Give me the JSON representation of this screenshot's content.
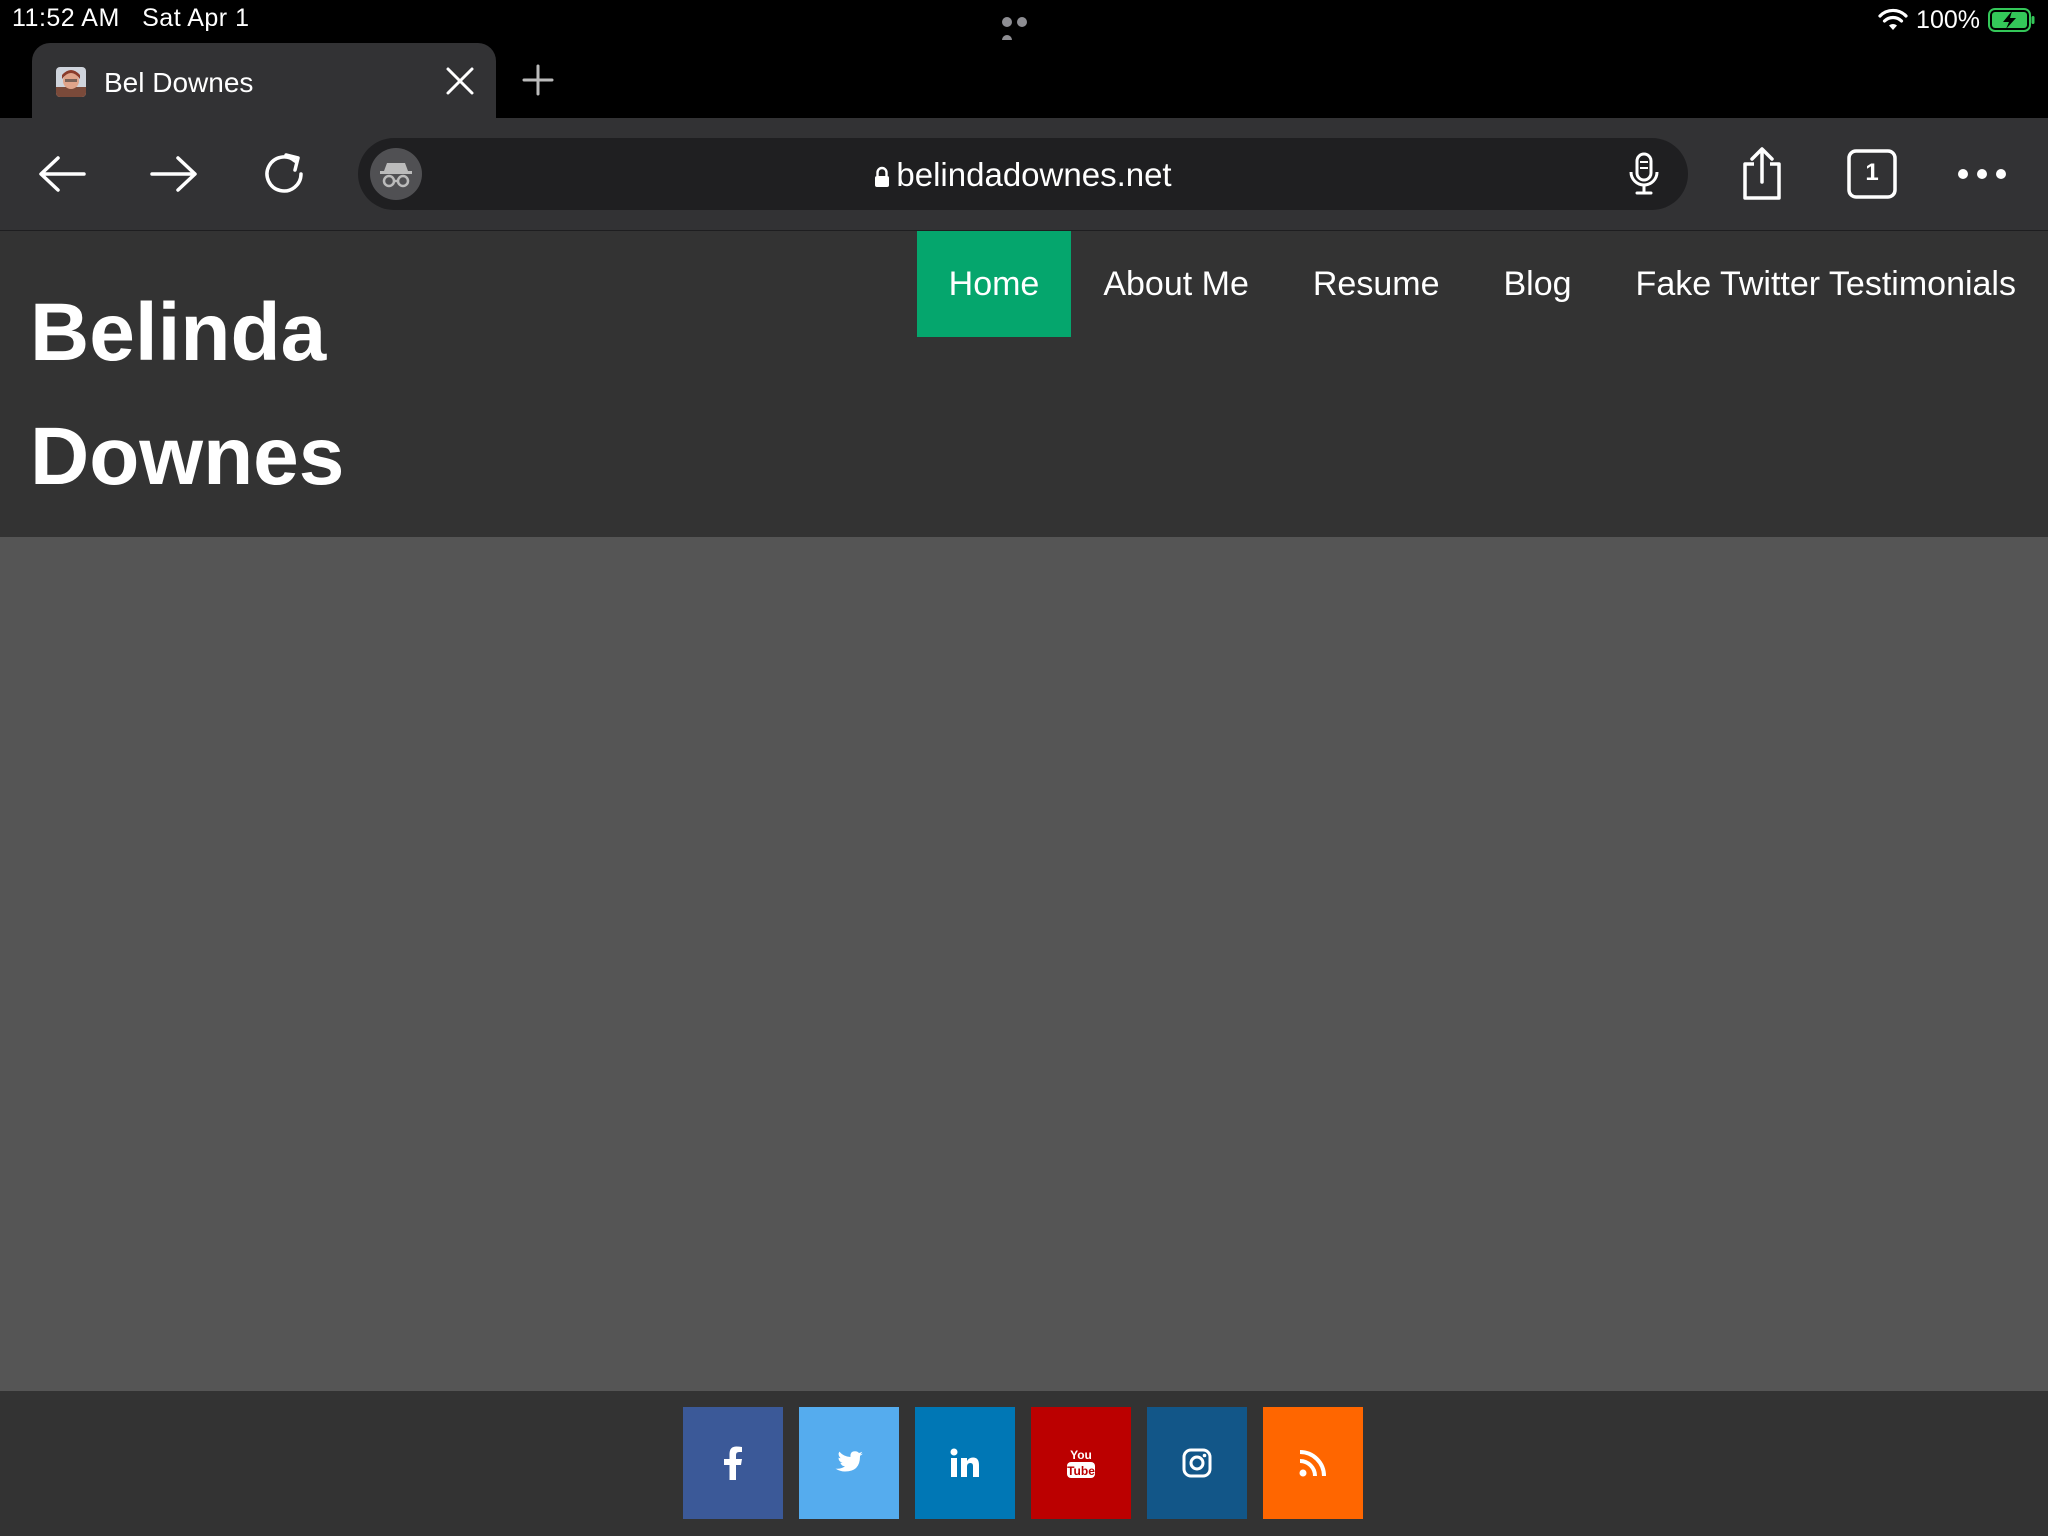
{
  "status_bar": {
    "time": "11:52 AM",
    "date": "Sat Apr 1",
    "battery": "100%"
  },
  "tab": {
    "title": "Bel Downes"
  },
  "toolbar": {
    "url": "belindadownes.net",
    "tab_count": "1"
  },
  "site": {
    "title_line1": "Belinda",
    "title_line2": "Downes",
    "nav": [
      "Home",
      "About Me",
      "Resume",
      "Blog",
      "Fake Twitter Testimonials"
    ],
    "active_nav": "Home",
    "accent_color": "#05a66d"
  },
  "social": [
    {
      "name": "facebook-icon",
      "color": "#3b5998"
    },
    {
      "name": "twitter-icon",
      "color": "#55acee"
    },
    {
      "name": "linkedin-icon",
      "color": "#0077b5"
    },
    {
      "name": "youtube-icon",
      "color": "#bb0000"
    },
    {
      "name": "instagram-icon",
      "color": "#125688"
    },
    {
      "name": "rss-icon",
      "color": "#ff6600"
    }
  ],
  "youtube_icon_text": [
    "You",
    "Tube"
  ]
}
